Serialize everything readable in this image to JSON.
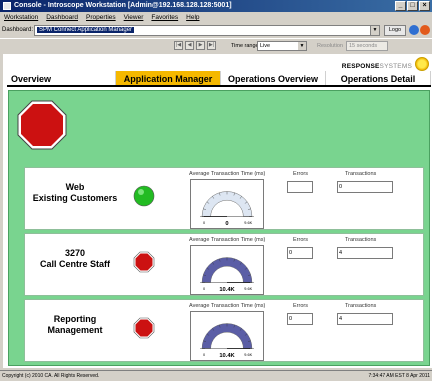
{
  "window": {
    "title": "Console - Introscope Workstation [Admin@192.168.128.128:5001]",
    "controls": {
      "minimize": "_",
      "maximize": "□",
      "close": "×"
    }
  },
  "menubar": [
    "Workstation",
    "Dashboard",
    "Properties",
    "Viewer",
    "Favorites",
    "Help"
  ],
  "dashbar": {
    "label": "Dashboard:",
    "selected": "SPM Connect Application Manager",
    "logo_button": "Logo"
  },
  "toolbar": {
    "time_range_label": "Time range",
    "time_range_value": "Live",
    "resolution_label": "Resolution",
    "resolution_value": "15 seconds"
  },
  "brand": {
    "bold": "RESPONSE",
    "light": "SYSTEMS"
  },
  "tabs": [
    {
      "label": "Overview"
    },
    {
      "label": "Application Manager",
      "active": true
    },
    {
      "label": "Operations Overview"
    },
    {
      "label": "Operations Detail"
    }
  ],
  "overall_status": {
    "color": "#cc1111",
    "icon": "stop-sign-icon"
  },
  "column_labels": {
    "gauge": "Average Transaction Time (ms)",
    "errors": "Errors",
    "transactions": "Transactions"
  },
  "services": [
    {
      "name_line1": "Web",
      "name_line2": "Existing Customers",
      "status": "ok",
      "status_color": "#22bb22",
      "gauge_value": "0",
      "gauge_min": "0",
      "gauge_max": "9.6K",
      "gauge_fill": 0,
      "errors": "",
      "transactions": "0"
    },
    {
      "name_line1": "3270",
      "name_line2": "Call Centre Staff",
      "status": "critical",
      "status_color": "#cc1111",
      "gauge_value": "10.4K",
      "gauge_min": "0",
      "gauge_max": "9.6K",
      "gauge_fill": 1,
      "errors": "0",
      "transactions": "4"
    },
    {
      "name_line1": "Reporting",
      "name_line2": "Management",
      "status": "critical",
      "status_color": "#cc1111",
      "gauge_value": "10.4K",
      "gauge_min": "0",
      "gauge_max": "9.6K",
      "gauge_fill": 1,
      "errors": "0",
      "transactions": "4"
    }
  ],
  "statusbar": {
    "copyright": "Copyright (c) 2010 CA. All Rights Reserved.",
    "time": "7:34:47 AM EST 8 Apr 2011"
  }
}
